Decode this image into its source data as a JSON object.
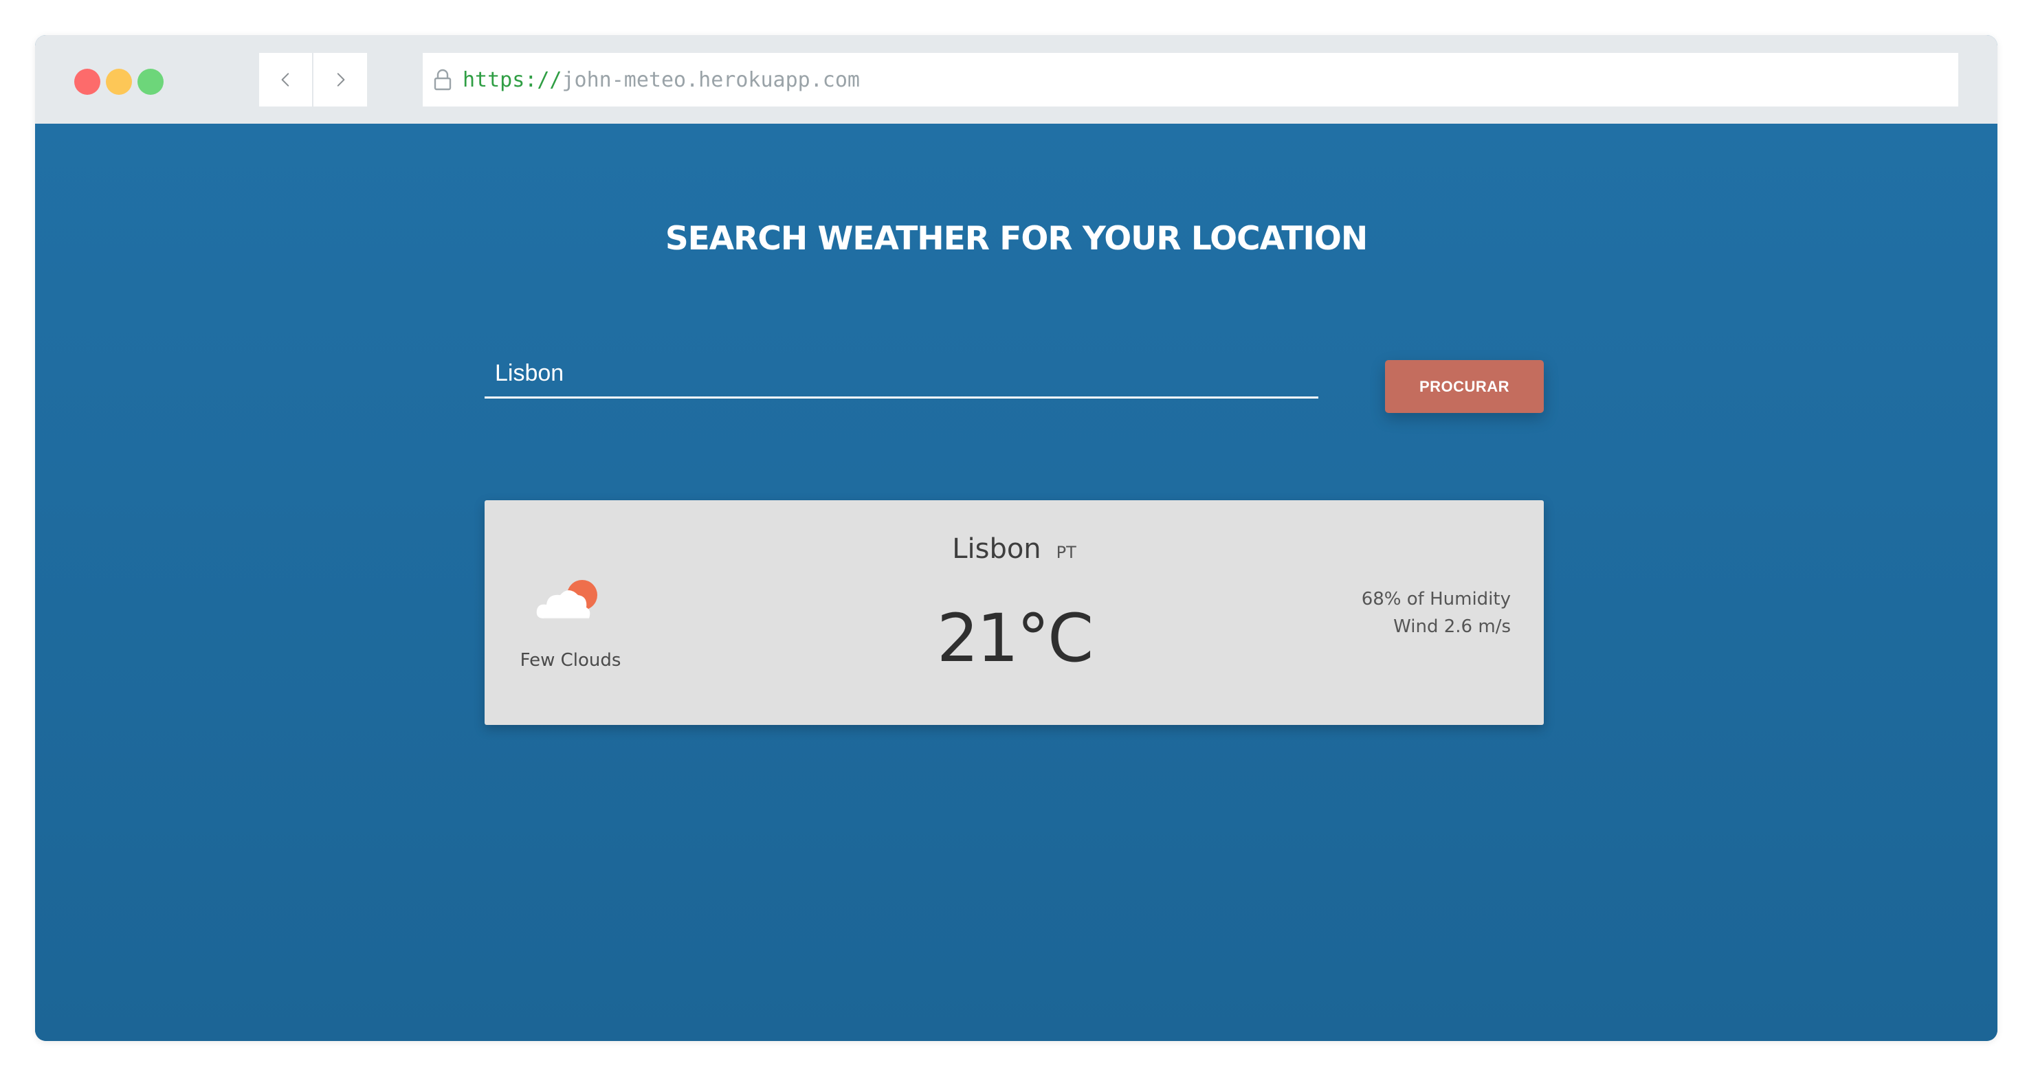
{
  "browser": {
    "traffic_lights": {
      "red": "#fd6b6b",
      "yellow": "#fdc757",
      "green": "#6dd67a"
    },
    "url_scheme": "https://",
    "url_rest": "john-meteo.herokuapp.com"
  },
  "page": {
    "title": "SEARCH WEATHER FOR YOUR LOCATION",
    "background_color": "#1f6ea3"
  },
  "search": {
    "value": "Lisbon",
    "button_label": "PROCURAR",
    "button_color": "#c46d5e"
  },
  "weather": {
    "icon": "few-clouds-icon",
    "description": "Few Clouds",
    "city": "Lisbon",
    "country": "PT",
    "temperature": "21°C",
    "humidity": "68% of Humidity",
    "wind": "Wind 2.6 m/s"
  }
}
